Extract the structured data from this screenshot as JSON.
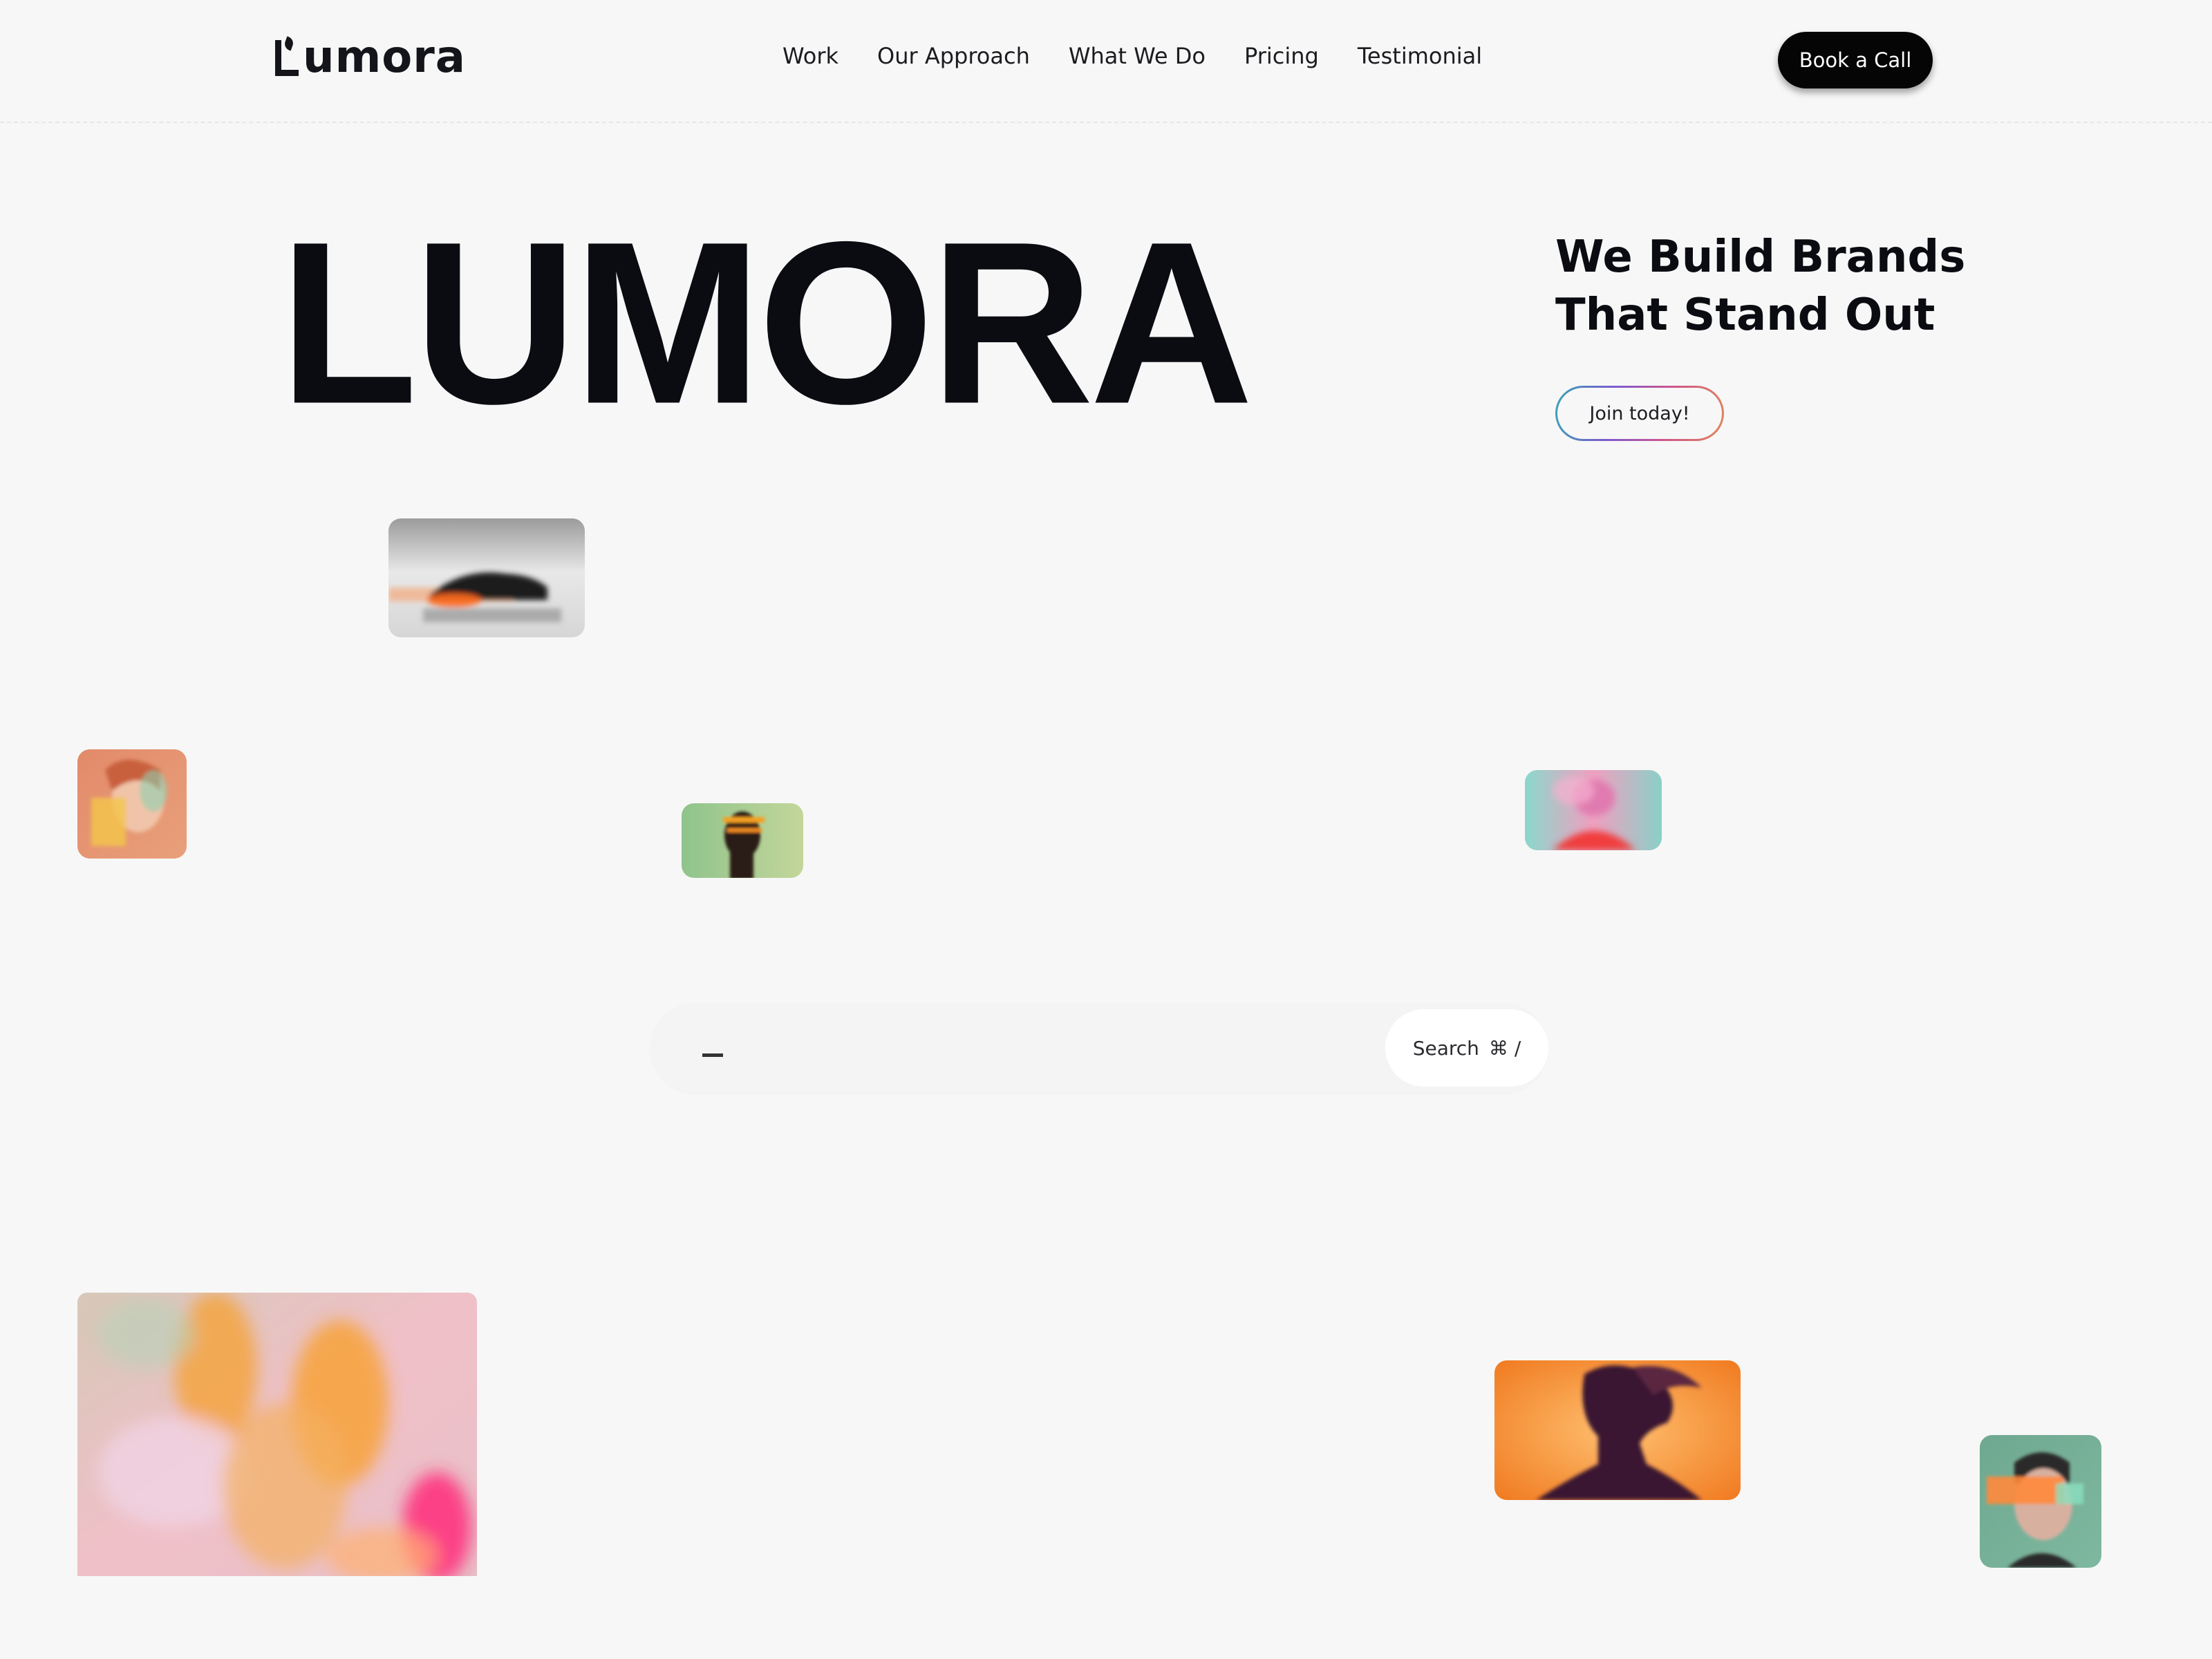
{
  "brand": {
    "name": "umora"
  },
  "nav": {
    "items": [
      {
        "label": "Work"
      },
      {
        "label": "Our Approach"
      },
      {
        "label": "What We Do"
      },
      {
        "label": "Pricing"
      },
      {
        "label": "Testimonial"
      }
    ],
    "cta_label": "Book a Call"
  },
  "hero": {
    "headline": "LUMORA",
    "tagline_line1": "We Build Brands",
    "tagline_line2": "That Stand Out",
    "join_label": "Join today!"
  },
  "search": {
    "button_label": "Search",
    "shortcut": "⌘ /"
  },
  "images": [
    {
      "name": "car-motion-image"
    },
    {
      "name": "woman-portrait-image"
    },
    {
      "name": "man-profile-image"
    },
    {
      "name": "pink-blur-portrait-image"
    },
    {
      "name": "abstract-flower-image"
    },
    {
      "name": "hair-silhouette-image"
    },
    {
      "name": "green-portrait-image"
    }
  ]
}
